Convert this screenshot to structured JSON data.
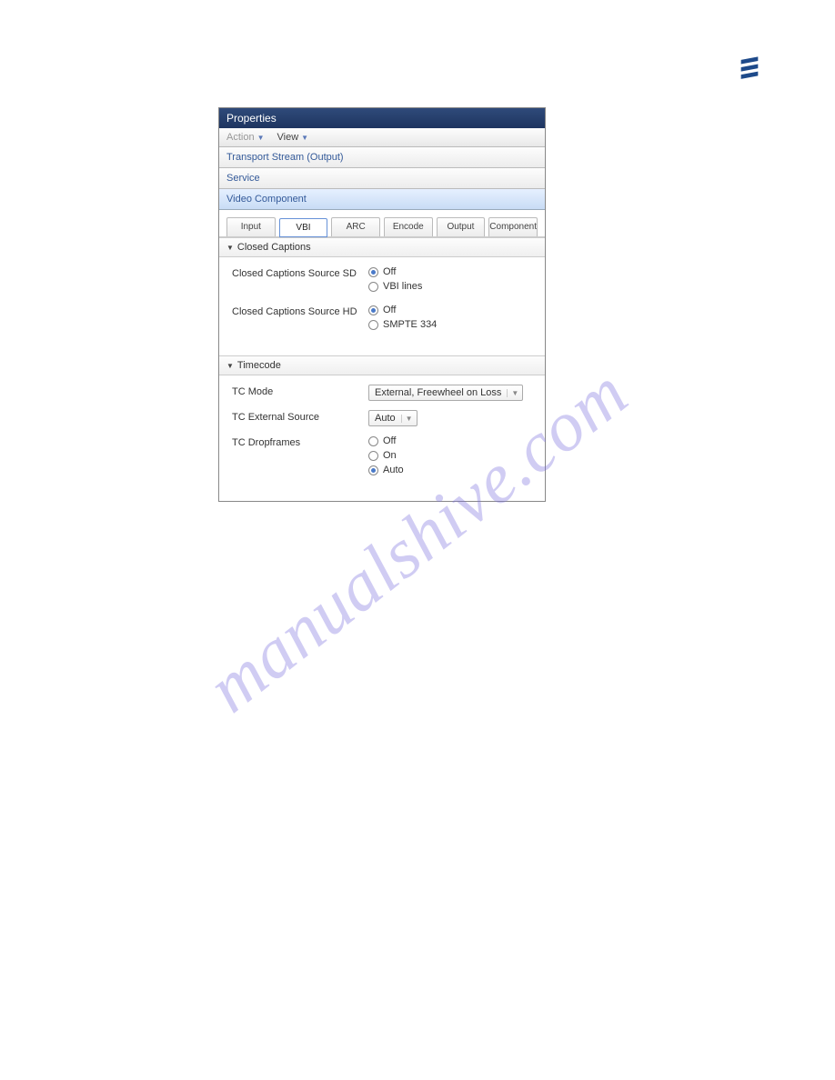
{
  "watermark": "manualshive.com",
  "panel": {
    "title": "Properties",
    "menu": {
      "action": "Action",
      "view": "View"
    },
    "crumbs": {
      "ts": "Transport Stream (Output)",
      "service": "Service",
      "video": "Video Component"
    },
    "tabs": {
      "input": "Input",
      "vbi": "VBI",
      "arc": "ARC",
      "encode": "Encode",
      "output": "Output",
      "component": "Component"
    },
    "sections": {
      "cc": {
        "title": "Closed Captions",
        "sd_label": "Closed Captions Source SD",
        "sd_opts": {
          "off": "Off",
          "vbi": "VBI lines"
        },
        "hd_label": "Closed Captions Source HD",
        "hd_opts": {
          "off": "Off",
          "smpte": "SMPTE 334"
        }
      },
      "tc": {
        "title": "Timecode",
        "mode_label": "TC Mode",
        "mode_value": "External, Freewheel on Loss",
        "ext_label": "TC External Source",
        "ext_value": "Auto",
        "drop_label": "TC Dropframes",
        "drop_opts": {
          "off": "Off",
          "on": "On",
          "auto": "Auto"
        }
      }
    }
  }
}
